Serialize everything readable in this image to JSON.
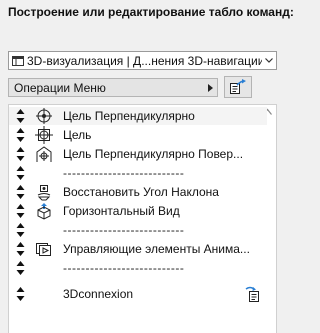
{
  "title": "Построение или редактирование табло команд:",
  "toolbar_select": {
    "value": "3D-визуализация | Д...нения 3D-навигации",
    "icon": "toolbar-icon"
  },
  "operations_menu": {
    "label": "Операции Меню",
    "icon": "chevron-right-icon"
  },
  "export_button": {
    "icon": "export-icon"
  },
  "items": [
    {
      "label": "Цель Перпендикулярно",
      "icon": "target-perpendicular-icon"
    },
    {
      "label": "Цель",
      "icon": "target-icon"
    },
    {
      "label": "Цель Перпендикулярно Повер...",
      "icon": "target-perpendicular-surface-icon"
    },
    {
      "label": "---------------------------",
      "icon": ""
    },
    {
      "label": "Восстановить Угол Наклона",
      "icon": "restore-tilt-icon"
    },
    {
      "label": "Горизонтальный Вид",
      "icon": "horizontal-view-icon"
    },
    {
      "label": "---------------------------",
      "icon": ""
    },
    {
      "label": "Управляющие элементы Анима...",
      "icon": "animation-controls-icon"
    },
    {
      "label": "---------------------------",
      "icon": ""
    },
    {
      "label": "3Dconnexion",
      "icon": "3dconnexion-icon",
      "right_icon": "submenu-icon"
    }
  ]
}
